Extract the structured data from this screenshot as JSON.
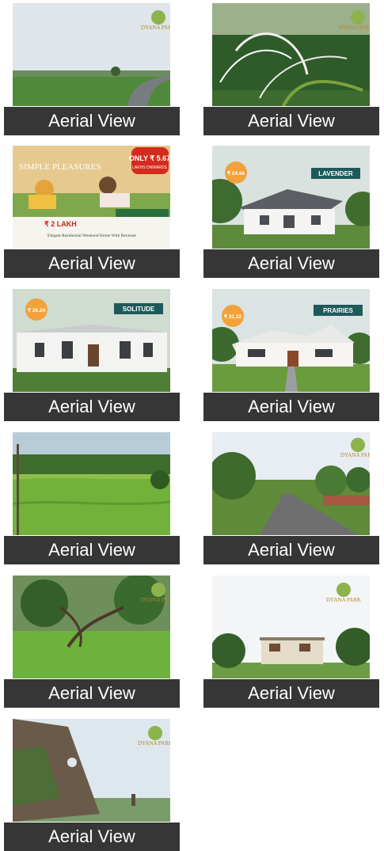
{
  "gallery": {
    "items": [
      {
        "caption": "Aerial View",
        "scene": "green fields with curving road",
        "logo": "DYANA PARK"
      },
      {
        "caption": "Aerial View",
        "scene": "spider lily flowers close-up",
        "logo": "DYANA PARK"
      },
      {
        "caption": "Aerial View",
        "scene": "promotional poster with children",
        "poster": {
          "heading": "SIMPLE PLEASURES",
          "badge": "ONLY ₹ 5.67",
          "badge_note": "LAKHS ONWARDS",
          "price": "₹ 2 LAKH",
          "tagline": "Elegant Residential Weekend Home With Revenue"
        }
      },
      {
        "caption": "Aerial View",
        "scene": "white cottage",
        "tag": "LAVENDER",
        "price_badge": "₹ 24.66"
      },
      {
        "caption": "Aerial View",
        "scene": "white villa with porch",
        "tag": "SOLITUDE",
        "price_badge": "₹ 26.24"
      },
      {
        "caption": "Aerial View",
        "scene": "farmhouse with lawn",
        "tag": "PRAIRIES",
        "price_badge": "₹ 31.22"
      },
      {
        "caption": "Aerial View",
        "scene": "open green meadow"
      },
      {
        "caption": "Aerial View",
        "scene": "paved road through trees",
        "logo": "DYANA PARK"
      },
      {
        "caption": "Aerial View",
        "scene": "park with large tree",
        "logo": "DYANA PARK"
      },
      {
        "caption": "Aerial View",
        "scene": "house among trees",
        "logo": "DYANA PARK"
      },
      {
        "caption": "Aerial View",
        "scene": "rocky cliff with valley",
        "logo": "DYANA PARK"
      }
    ]
  },
  "colors": {
    "caption_bg": "#363636",
    "caption_text": "#ffffff",
    "badge_red": "#d42b1f",
    "badge_orange": "#f2a23a",
    "tag_teal": "#1f5a5a"
  }
}
